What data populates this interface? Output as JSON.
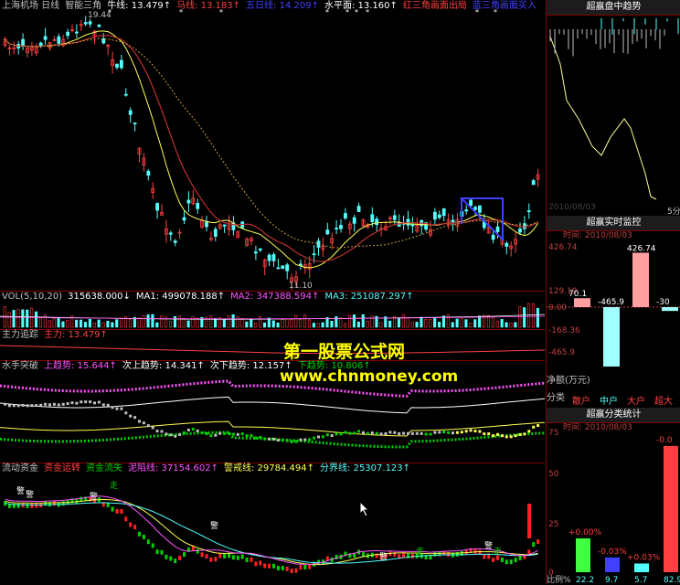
{
  "colors": {
    "bg": "#000000",
    "up": "#ff4040",
    "down": "#54ffff",
    "border": "#800000",
    "yellow": "#ffff54",
    "magenta": "#ff54ff",
    "green": "#00d000",
    "white": "#ffffff"
  },
  "main": {
    "header": [
      {
        "text": "上海机场 日线",
        "color": "#c0c0c0"
      },
      {
        "text": "智能三角",
        "color": "#c0c0c0"
      },
      {
        "text": "牛线: 13.479↑",
        "color": "#ffffff"
      },
      {
        "text": "马线: 13.183↑",
        "color": "#ff4040"
      },
      {
        "text": "五日线: 14.209↑",
        "color": "#4040ff"
      },
      {
        "text": "水平面: 13.160↑",
        "color": "#ffffff"
      },
      {
        "text": "红三角画面出局",
        "color": "#ff4040"
      },
      {
        "text": "蓝三角画面买入",
        "color": "#4040ff"
      }
    ],
    "high_label": "19.44",
    "low_label": "11.10"
  },
  "volume": {
    "header": [
      {
        "text": "VOL(5,10,20)",
        "color": "#c0c0c0"
      },
      {
        "text": "315638.000↓",
        "color": "#ffffff"
      },
      {
        "text": "MA1: 499078.188↑",
        "color": "#ffffff"
      },
      {
        "text": "MA2: 347388.594↑",
        "color": "#ff54ff"
      },
      {
        "text": "MA3: 251087.297↑",
        "color": "#54ffff"
      }
    ]
  },
  "zhuli": {
    "header": [
      {
        "text": "主力追踪",
        "color": "#c0c0c0"
      },
      {
        "text": "主力: 13.479↑",
        "color": "#ff4040"
      }
    ]
  },
  "shuishou": {
    "header": [
      {
        "text": "水手突破",
        "color": "#c0c0c0"
      },
      {
        "text": "上趋势: 15.644↑",
        "color": "#ff54ff"
      },
      {
        "text": "次上趋势: 14.341↑",
        "color": "#ffffff"
      },
      {
        "text": "次下趋势: 12.157↑",
        "color": "#ffffff"
      },
      {
        "text": "下趋势: 10.806↑",
        "color": "#00d000"
      }
    ]
  },
  "liudong": {
    "header": [
      {
        "text": "流动资金",
        "color": "#c0c0c0"
      },
      {
        "text": "资金运转",
        "color": "#ff4040"
      },
      {
        "text": "资金流失",
        "color": "#00d000"
      },
      {
        "text": "泥陷线: 37154.602↑",
        "color": "#ff54ff"
      },
      {
        "text": "警戒线: 29784.494↑",
        "color": "#ffff54"
      },
      {
        "text": "分界线: 25307.123↑",
        "color": "#54ffff"
      }
    ],
    "marks": [
      "警",
      "警",
      "警",
      "走",
      "警",
      "警",
      "走",
      "警",
      "走"
    ]
  },
  "watermark": {
    "line1": "第一股票公式网",
    "line2": "www.chnmoney.com"
  },
  "side1": {
    "title": "超赢盘中趋势",
    "date": "2010/08/03",
    "right_label": "5分"
  },
  "side2": {
    "title": "超赢实时监控",
    "time_label": "时间: 2010/08/03",
    "axis": [
      "426.74",
      "129.19",
      "0.00",
      "-168.36",
      "-465.9"
    ],
    "unit": "净额(万元)",
    "bars": [
      {
        "label": "70.1",
        "value": 70.1
      },
      {
        "label": "-465.9",
        "value": -465.9
      },
      {
        "label": "426.74",
        "value": 426.74
      },
      {
        "label": "-30",
        "value": -30
      }
    ],
    "categories_label": "分类",
    "categories": [
      "散户",
      "中户",
      "大户",
      "超大"
    ]
  },
  "side3": {
    "title": "超赢分类统计",
    "time_label": "时间: 2010/08/03",
    "axis": [
      "75",
      "50",
      "25",
      "0"
    ],
    "bars": [
      {
        "value": 22.2,
        "label": "+0.00%",
        "bottom": "22.2"
      },
      {
        "value": 9.7,
        "label": "-0.03%",
        "bottom": "9.7"
      },
      {
        "value": 5.7,
        "label": "+0.03%",
        "bottom": "5.7"
      },
      {
        "value": 82.9,
        "label": "-0.0",
        "bottom": "82.9"
      }
    ],
    "footer_label": "比例%"
  }
}
